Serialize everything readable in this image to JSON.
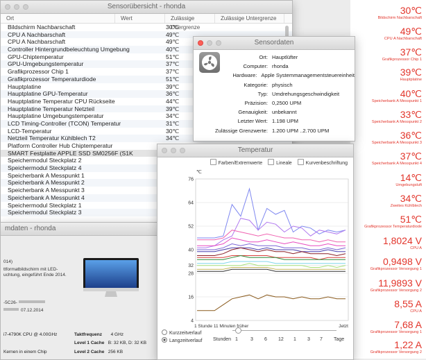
{
  "list_window": {
    "title": "Sensorübersicht - rhonda",
    "columns": [
      "Ort",
      "Wert",
      "Zulässige Obergrenze",
      "Zulässige Untergrenze"
    ],
    "rows": [
      {
        "name": "Bildschirm Nachbarschaft",
        "value": "30℃"
      },
      {
        "name": "CPU A Nachbarschaft",
        "value": "49℃"
      },
      {
        "name": "CPU A Nachbarschaft",
        "value": "49℃"
      },
      {
        "name": "Controller Hintergrundbeleuchtung Umgebung",
        "value": "40℃"
      },
      {
        "name": "GPU-Chiptemperatur",
        "value": "51℃"
      },
      {
        "name": "GPU-Umgebungstemperatur",
        "value": "37℃"
      },
      {
        "name": "Grafikprozessor Chip 1",
        "value": "37℃"
      },
      {
        "name": "Grafikprozessor Temperaturdiode",
        "value": "51℃"
      },
      {
        "name": "Hauptplatine",
        "value": "39℃"
      },
      {
        "name": "Hauptplatine GPU-Temperatur",
        "value": "36℃"
      },
      {
        "name": "Hauptplatine Temperatur CPU Rückseite",
        "value": "44℃"
      },
      {
        "name": "Hauptplatine Temperatur Netzteil",
        "value": "39℃"
      },
      {
        "name": "Hauptplatine Umgebungstemperatur",
        "value": "34℃"
      },
      {
        "name": "LCD Timing-Controller (TCON) Temperatur",
        "value": "31℃"
      },
      {
        "name": "LCD-Temperatur",
        "value": "30℃"
      },
      {
        "name": "Netzteil Temperatur Kühlblech T2",
        "value": "34℃"
      },
      {
        "name": "Platform Controller Hub Chiptemperatur",
        "value": "57℃"
      },
      {
        "name": "SMART Festplatte APPLE SSD SM0256F (S1K",
        "value": ""
      },
      {
        "name": "Speichermodul Steckplatz 2",
        "value": ""
      },
      {
        "name": "Speichermodul Steckplatz 4",
        "value": ""
      },
      {
        "name": "Speicherbank A Messpunkt 1",
        "value": ""
      },
      {
        "name": "Speicherbank A Messpunkt 2",
        "value": ""
      },
      {
        "name": "Speicherbank A Messpunkt 3",
        "value": ""
      },
      {
        "name": "Speicherbank A Messpunkt 4",
        "value": ""
      },
      {
        "name": "Speichermodul Steckplatz 1",
        "value": ""
      },
      {
        "name": "Speichermodul Steckplatz 3",
        "value": ""
      }
    ]
  },
  "detail_window": {
    "title": "Sensordaten",
    "icon": "fan-icon",
    "fields": [
      {
        "k": "Ort:",
        "v": "Hauptlüfter"
      },
      {
        "k": "Computer:",
        "v": "rhonda"
      },
      {
        "k": "Hardware:",
        "v": "Apple Systemmanagementsteuereinheit"
      },
      {
        "k": "Kategorie:",
        "v": "physisch"
      },
      {
        "k": "Typ:",
        "v": "Umdrehungsgeschwindigkeit"
      },
      {
        "k": "Präzision:",
        "v": "0,2500 UPM"
      },
      {
        "k": "Genauigkeit:",
        "v": "unbekannt"
      },
      {
        "k": "Letzter Wert:",
        "v": "1.198 UPM"
      },
      {
        "k": "Zulässige Grenzwerte:",
        "v": "1.200 UPM ..2.700 UPM"
      }
    ]
  },
  "chart_window": {
    "title": "Temperatur",
    "options": [
      "Farben/Extremwerte",
      "Lineale",
      "Kurvenbeschriftung"
    ],
    "radio_short": "Kurzzeitverlauf",
    "radio_long": "Langzeitverlauf",
    "hours_label": "Stunden",
    "hour_ticks": [
      "1",
      "3",
      "6",
      "12",
      "1",
      "3",
      "7"
    ],
    "days_label": "Tage"
  },
  "chart_data": {
    "type": "line",
    "unit_label": "℃",
    "yticks": [
      4,
      16,
      28,
      32,
      40,
      52,
      64,
      76
    ],
    "ylim": [
      4,
      76
    ],
    "x_label_left": "1 Stunde 11 Minuten  früher",
    "x_label_right": "Jetzt",
    "series": [
      {
        "color": "#7d86f0",
        "values": [
          46,
          46,
          46,
          47,
          63,
          57,
          71,
          50,
          61,
          58,
          60,
          49,
          52,
          51,
          48,
          50,
          49,
          50
        ]
      },
      {
        "color": "#b078ef",
        "values": [
          41,
          41,
          42,
          45,
          47,
          56,
          55,
          50,
          54,
          53,
          49,
          52,
          51,
          47,
          50,
          49,
          48,
          50
        ]
      },
      {
        "color": "#ef62b0",
        "values": [
          45,
          45,
          45,
          46,
          50,
          49,
          48,
          47,
          48,
          47,
          46,
          46,
          45,
          45,
          44,
          45,
          44,
          44
        ]
      },
      {
        "color": "#e84ac0",
        "values": [
          42,
          42,
          42,
          43,
          46,
          45,
          44,
          44,
          45,
          44,
          43,
          44,
          43,
          42,
          42,
          43,
          42,
          42
        ]
      },
      {
        "color": "#7a66d6",
        "values": [
          40,
          40,
          40,
          41,
          43,
          42,
          43,
          42,
          42,
          42,
          41,
          41,
          41,
          40,
          40,
          41,
          40,
          41
        ]
      },
      {
        "color": "#4a3fae",
        "values": [
          39,
          39,
          39,
          40,
          41,
          41,
          41,
          40,
          41,
          40,
          40,
          40,
          39,
          39,
          39,
          40,
          39,
          39
        ]
      },
      {
        "color": "#8a1f26",
        "values": [
          37,
          37,
          37,
          38,
          40,
          41,
          40,
          39,
          40,
          39,
          39,
          38,
          39,
          38,
          38,
          38,
          37,
          38
        ]
      },
      {
        "color": "#d7403a",
        "values": [
          36,
          36,
          36,
          36,
          37,
          37,
          37,
          37,
          37,
          36,
          36,
          36,
          36,
          36,
          35,
          36,
          36,
          36
        ]
      },
      {
        "color": "#2e8c3a",
        "values": [
          35,
          35,
          35,
          35,
          36,
          37,
          36,
          36,
          36,
          36,
          35,
          35,
          35,
          35,
          35,
          35,
          35,
          35
        ]
      },
      {
        "color": "#7fd6e8",
        "values": [
          33,
          33,
          33,
          33,
          34,
          34,
          34,
          34,
          34,
          33,
          33,
          33,
          33,
          33,
          33,
          33,
          33,
          33
        ]
      },
      {
        "color": "#a6e07a",
        "values": [
          32,
          32,
          32,
          32,
          32,
          32,
          33,
          32,
          32,
          32,
          32,
          32,
          32,
          31,
          31,
          32,
          31,
          32
        ]
      },
      {
        "color": "#c4b55c",
        "values": [
          30,
          30,
          30,
          30,
          31,
          31,
          31,
          31,
          31,
          30,
          30,
          30,
          30,
          30,
          30,
          30,
          30,
          30
        ]
      },
      {
        "color": "#333333",
        "values": [
          29,
          29,
          29,
          29,
          30,
          30,
          30,
          30,
          30,
          29,
          29,
          29,
          29,
          29,
          29,
          29,
          29,
          29
        ]
      },
      {
        "color": "#8a5a1c",
        "values": [
          9,
          9,
          9,
          12,
          15,
          16,
          17,
          15,
          17,
          16,
          16,
          15,
          16,
          15,
          15,
          16,
          15,
          15
        ]
      }
    ]
  },
  "about_window": {
    "title": "mdaten - rhonda",
    "line_year": "014)",
    "line_desc1": "ttformatbildschirm mit LED-",
    "line_desc2": "uchtung, eingeführt Ende 2014.",
    "line_serial": "-5C26-",
    "line_date": "07.12.2014",
    "cpu": "i7-4790K CPU @ 4.00GHz",
    "kernels": "Kernen in einem Chip",
    "clock_label": "Taktfrequenz",
    "clock_value": "4 GHz",
    "l1_label": "Level 1 Cache",
    "l1_value": "B: 32 KB, D: 32 KB",
    "l2_label": "Level 2 Cache",
    "l2_value": "256 KB"
  },
  "readouts": [
    {
      "value": "30℃",
      "label": "Bildschirm Nachbarschaft"
    },
    {
      "value": "49℃",
      "label": "CPU A Nachbarschaft"
    },
    {
      "value": "37℃",
      "label": "Grafikprozessor Chip 1"
    },
    {
      "value": "39℃",
      "label": "Hauptplatine"
    },
    {
      "value": "40℃",
      "label": "Speicherbank A Messpunkt 1"
    },
    {
      "value": "33℃",
      "label": "Speicherbank A Messpunkt 2"
    },
    {
      "value": "36℃",
      "label": "Speicherbank A Messpunkt 3"
    },
    {
      "value": "37℃",
      "label": "Speicherbank A Messpunkt 4"
    },
    {
      "value": "14℃",
      "label": "Umgebungsluft"
    },
    {
      "value": "34℃",
      "label": "Zweites Kühlblech"
    },
    {
      "value": "51℃",
      "label": "Grafikprozessor Temperaturdiode"
    },
    {
      "value": "1,8024 V",
      "label": "CPU A"
    },
    {
      "value": "0,9498 V",
      "label": "Grafikprozessor Versorgung 1"
    },
    {
      "value": "11,9893 V",
      "label": "Grafikprozessor Versorgung 2"
    },
    {
      "value": "8,55 A",
      "label": "CPU A"
    },
    {
      "value": "7,68 A",
      "label": "Grafikprozessor Versorgung 1"
    },
    {
      "value": "1,22 A",
      "label": "Grafikprozessor Versorgung 2"
    }
  ]
}
